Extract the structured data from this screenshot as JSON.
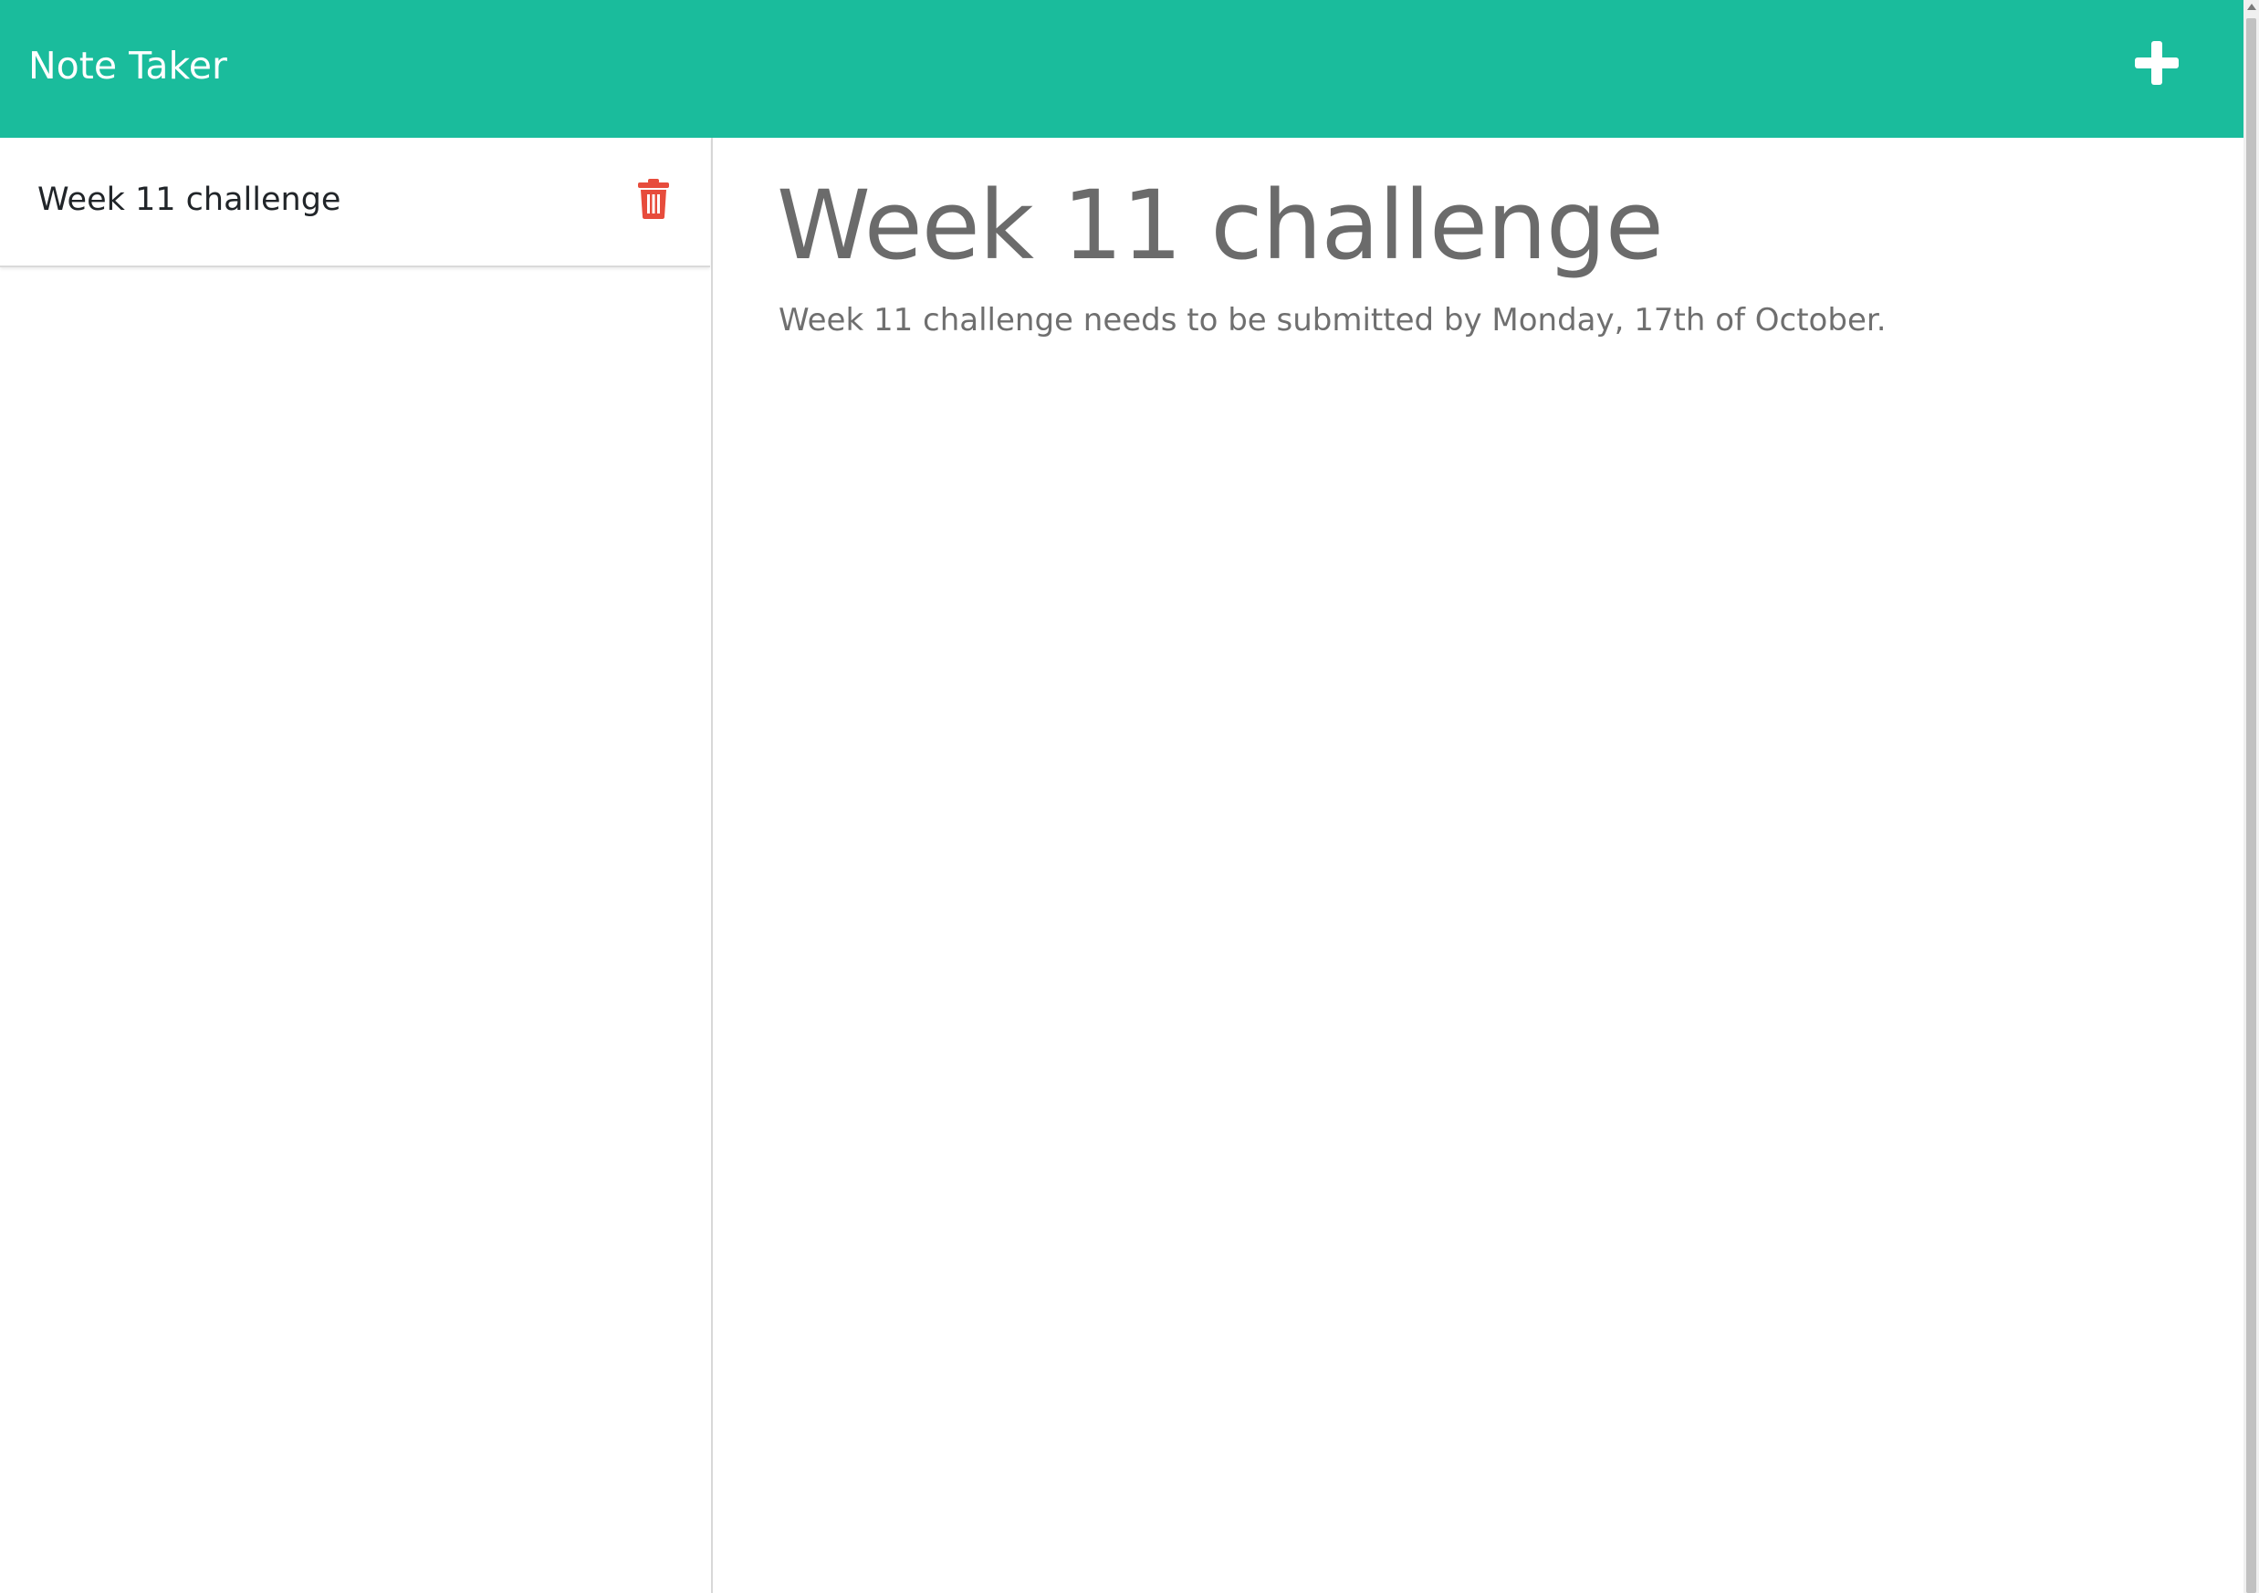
{
  "navbar": {
    "brand": "Note Taker",
    "add_button_icon": "plus-icon",
    "background_color": "#1abc9c"
  },
  "sidebar": {
    "notes": [
      {
        "title": "Week 11 challenge",
        "delete_icon": "trash-icon"
      }
    ]
  },
  "main": {
    "note_title": "Week 11 challenge",
    "note_text": "Week 11 challenge needs to be submitted by Monday, 17th of October."
  },
  "colors": {
    "accent": "#1abc9c",
    "delete": "#e74c3c",
    "heading_text": "#6b6b6b"
  }
}
